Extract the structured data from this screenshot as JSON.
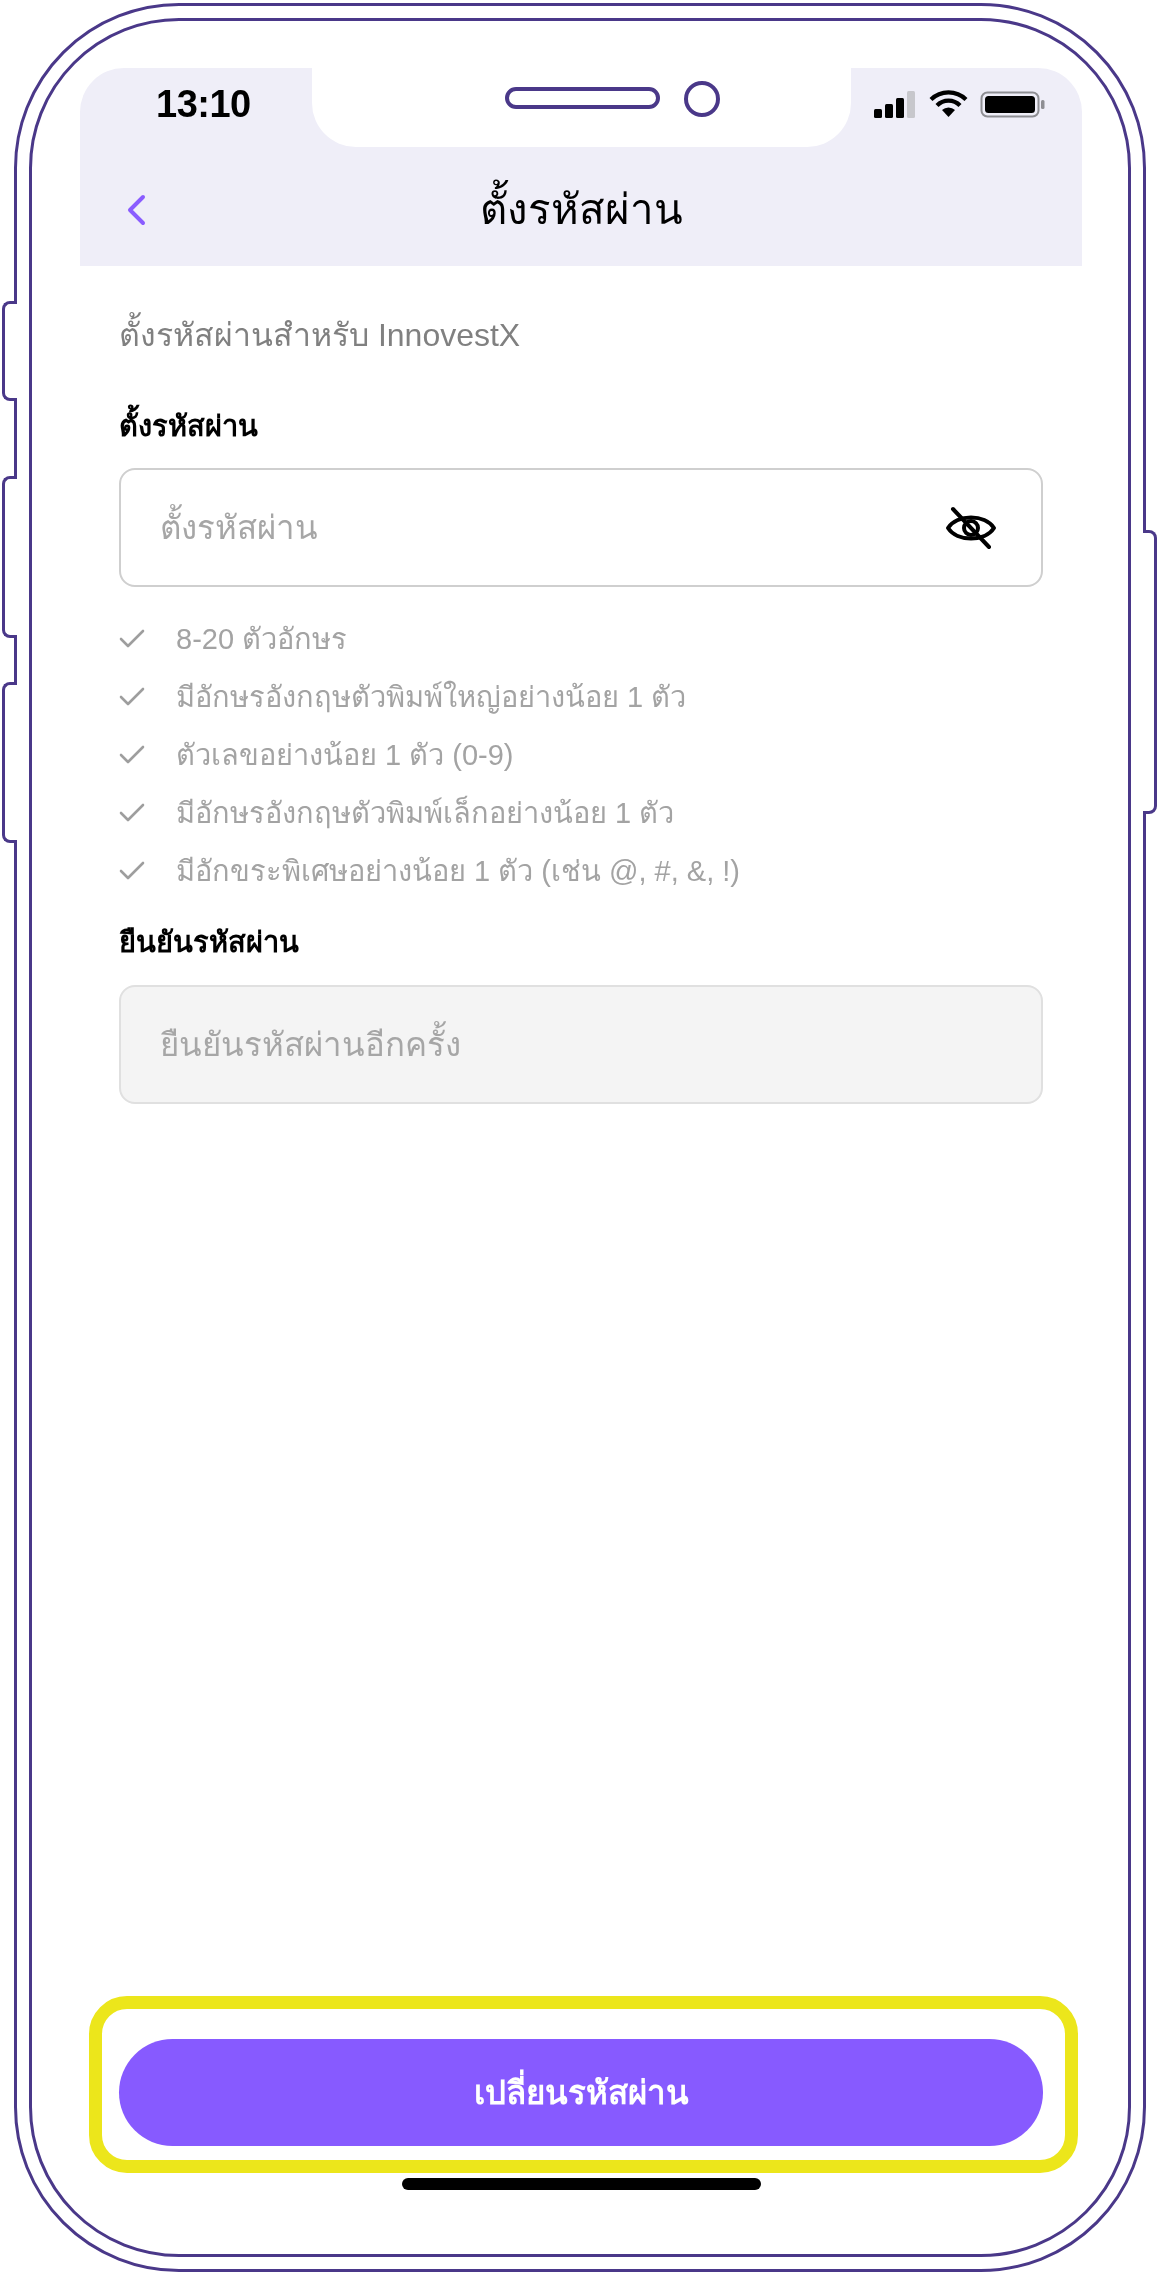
{
  "status_bar": {
    "time": "13:10"
  },
  "nav_bar": {
    "title": "ตั้งรหัสผ่าน"
  },
  "intro": "ตั้งรหัสผ่านสำหรับ InnovestX",
  "password_field": {
    "label": "ตั้งรหัสผ่าน",
    "placeholder": "ตั้งรหัสผ่าน",
    "disabled": false
  },
  "password_rules": [
    "8-20 ตัวอักษร",
    "มีอักษรอังกฤษตัวพิมพ์ใหญ่อย่างน้อย 1 ตัว",
    "ตัวเลขอย่างน้อย 1 ตัว (0-9)",
    "มีอักษรอังกฤษตัวพิมพ์เล็กอย่างน้อย 1 ตัว",
    "มีอักขระพิเศษอย่างน้อย 1 ตัว (เช่น @, #, &, !)"
  ],
  "confirm_field": {
    "label": "ยืนยันรหัสผ่าน",
    "placeholder": "ยืนยันรหัสผ่านอีกครั้ง",
    "disabled": true
  },
  "submit_button": {
    "label": "เปลี่ยนรหัสผ่าน",
    "highlighted": true
  }
}
